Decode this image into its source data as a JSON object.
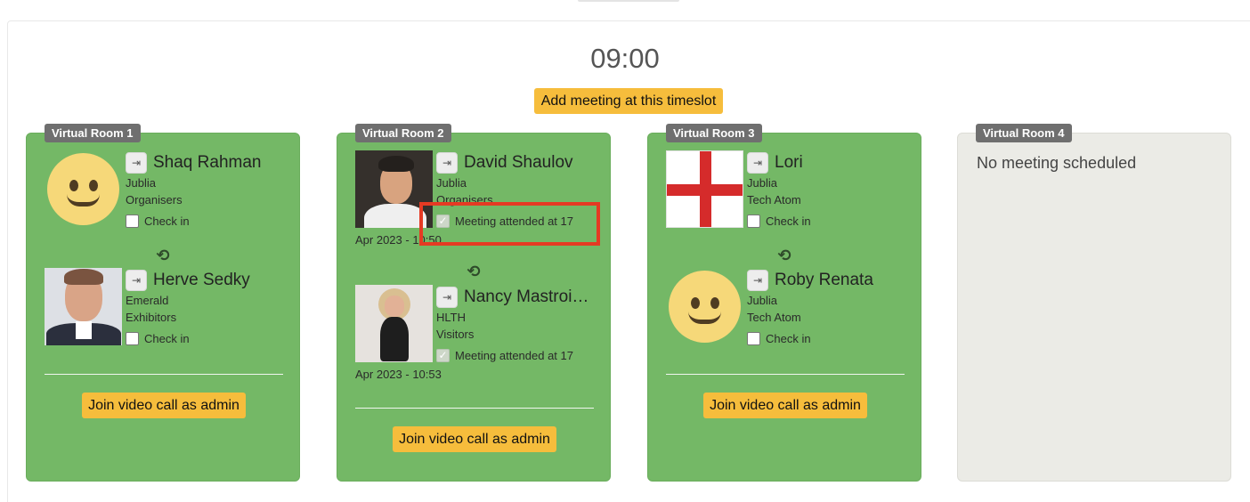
{
  "timeslot": {
    "time": "09:00",
    "add_button": "Add meeting at this timeslot"
  },
  "rooms": [
    {
      "label": "Virtual Room 1",
      "people": [
        {
          "name": "Shaq Rahman",
          "company": "Jublia",
          "group": "Organisers",
          "check_label": "Check in",
          "photo": "smiley-avatar"
        },
        {
          "name": "Herve Sedky",
          "company": "Emerald",
          "group": "Exhibitors",
          "check_label": "Check in",
          "photo": "man-in-suit-photo"
        }
      ],
      "join_button": "Join video call as admin"
    },
    {
      "label": "Virtual Room 2",
      "people": [
        {
          "name": "David Shaulov",
          "company": "Jublia",
          "group": "Organisers",
          "check_label": "Meeting attended at 17",
          "date": "Apr 2023 - 10:50",
          "photo": "man-dark-background-photo"
        },
        {
          "name": "Nancy Mastroi…",
          "company": "HLTH",
          "group": "Visitors",
          "check_label": "Meeting attended at 17",
          "date": "Apr 2023 - 10:53",
          "photo": "woman-sitting-photo"
        }
      ],
      "join_button": "Join video call as admin"
    },
    {
      "label": "Virtual Room 3",
      "people": [
        {
          "name": "Lori",
          "company": "Jublia",
          "group": "Tech Atom",
          "check_label": "Check in",
          "photo": "england-flag-avatar"
        },
        {
          "name": "Roby Renata",
          "company": "Jublia",
          "group": "Tech Atom",
          "check_label": "Check in",
          "photo": "smiley-avatar"
        }
      ],
      "join_button": "Join video call as admin"
    },
    {
      "label": "Virtual Room 4",
      "empty_text": "No meeting scheduled"
    }
  ],
  "icons": {
    "login": "login-icon",
    "swap": "swap-icon",
    "checkmark": "checkmark-icon"
  },
  "colors": {
    "room_green": "#74b866",
    "room_empty": "#ebebe6",
    "button_yellow": "#f6bd3c",
    "badge_gray": "#6f6f6f",
    "highlight_red": "#e53a23"
  }
}
